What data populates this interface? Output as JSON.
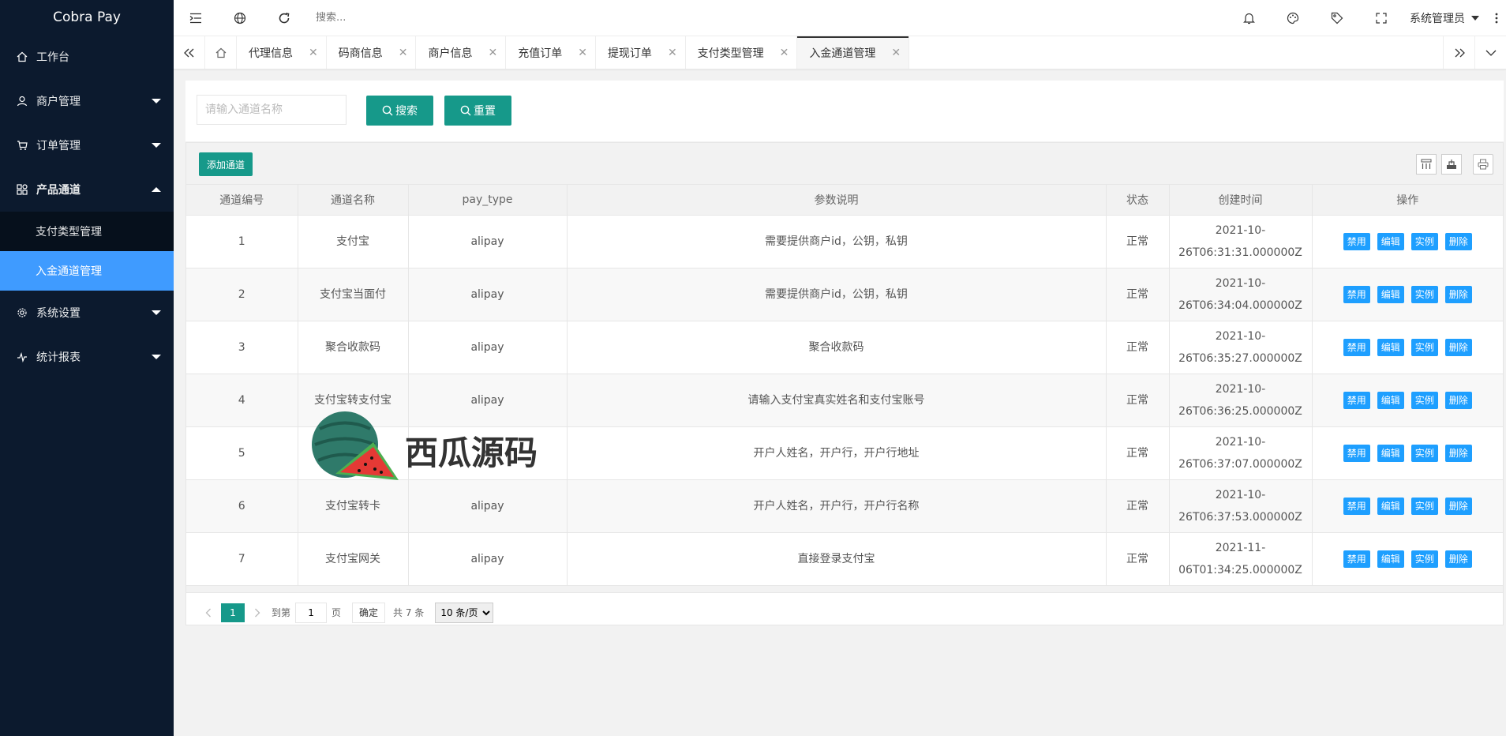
{
  "app": {
    "brand": "Cobra Pay"
  },
  "sidebar": {
    "items": [
      {
        "label": "工作台",
        "icon": "home-icon"
      },
      {
        "label": "商户管理",
        "icon": "user-icon"
      },
      {
        "label": "订单管理",
        "icon": "cart-icon"
      },
      {
        "label": "产品通道",
        "icon": "apps-icon",
        "expanded": true,
        "children": [
          {
            "label": "支付类型管理"
          },
          {
            "label": "入金通道管理",
            "selected": true
          }
        ]
      },
      {
        "label": "系统设置",
        "icon": "gear-icon"
      },
      {
        "label": "统计报表",
        "icon": "chart-line-icon"
      }
    ]
  },
  "header": {
    "search_placeholder": "搜索...",
    "user_name": "系统管理员"
  },
  "tabs": [
    {
      "label": "代理信息"
    },
    {
      "label": "码商信息"
    },
    {
      "label": "商户信息"
    },
    {
      "label": "充值订单"
    },
    {
      "label": "提现订单"
    },
    {
      "label": "支付类型管理"
    },
    {
      "label": "入金通道管理",
      "active": true
    }
  ],
  "search": {
    "placeholder": "请输入通道名称",
    "search_label": "搜索",
    "reset_label": "重置"
  },
  "toolbar": {
    "add_label": "添加通道"
  },
  "table": {
    "columns": [
      "通道编号",
      "通道名称",
      "pay_type",
      "参数说明",
      "状态",
      "创建时间",
      "操作"
    ],
    "actions": [
      "禁用",
      "编辑",
      "实例",
      "删除"
    ],
    "rows": [
      {
        "id": "1",
        "name": "支付宝",
        "pay_type": "alipay",
        "desc": "需要提供商户id，公钥，私钥",
        "status": "正常",
        "time_a": "2021-10-",
        "time_b": "26T06:31:31.000000Z"
      },
      {
        "id": "2",
        "name": "支付宝当面付",
        "pay_type": "alipay",
        "desc": "需要提供商户id，公钥，私钥",
        "status": "正常",
        "time_a": "2021-10-",
        "time_b": "26T06:34:04.000000Z"
      },
      {
        "id": "3",
        "name": "聚合收款码",
        "pay_type": "alipay",
        "desc": "聚合收款码",
        "status": "正常",
        "time_a": "2021-10-",
        "time_b": "26T06:35:27.000000Z"
      },
      {
        "id": "4",
        "name": "支付宝转支付宝",
        "pay_type": "alipay",
        "desc": "请输入支付宝真实姓名和支付宝账号",
        "status": "正常",
        "time_a": "2021-10-",
        "time_b": "26T06:36:25.000000Z"
      },
      {
        "id": "5",
        "name": "",
        "pay_type": "ali",
        "desc": "开户人姓名，开户行，开户行地址",
        "status": "正常",
        "time_a": "2021-10-",
        "time_b": "26T06:37:07.000000Z"
      },
      {
        "id": "6",
        "name": "支付宝转卡",
        "pay_type": "alipay",
        "desc": "开户人姓名，开户行，开户行名称",
        "status": "正常",
        "time_a": "2021-10-",
        "time_b": "26T06:37:53.000000Z"
      },
      {
        "id": "7",
        "name": "支付宝网关",
        "pay_type": "alipay",
        "desc": "直接登录支付宝",
        "status": "正常",
        "time_a": "2021-11-",
        "time_b": "06T01:34:25.000000Z"
      }
    ]
  },
  "pager": {
    "current": "1",
    "goto_label": "到第",
    "goto_value": "1",
    "page_unit": "页",
    "confirm_label": "确定",
    "total_label": "共 7 条",
    "page_size": "10 条/页"
  },
  "watermark": {
    "text": "西瓜源码"
  },
  "colors": {
    "sidebar_bg": "#0c1a2e",
    "selected_menu": "#3f9bff",
    "primary_green": "#16998a",
    "action_blue": "#1e9fff"
  }
}
